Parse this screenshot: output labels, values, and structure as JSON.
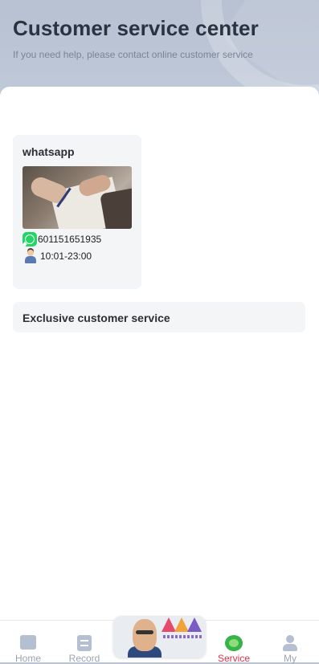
{
  "header": {
    "title": "Customer service center",
    "subtitle": "If you need help, please contact online customer service"
  },
  "whatsapp_card": {
    "title": "whatsapp",
    "phone": "601151651935",
    "hours": "10:01-23:00"
  },
  "exclusive_card": {
    "label": "Exclusive customer service"
  },
  "tabbar": {
    "items": [
      {
        "label": "Home",
        "icon": "home-icon"
      },
      {
        "label": "Record",
        "icon": "record-icon"
      },
      {
        "label": "Service",
        "icon": "service-icon",
        "active": true
      },
      {
        "label": "My",
        "icon": "profile-icon"
      }
    ],
    "center_button": {
      "icon": "game-logo-icon"
    }
  },
  "colors": {
    "header_bg": "#b9c3d3",
    "card_bg": "#f4f5f6",
    "active_tab": "#e0304a",
    "inactive_tab": "#9aa3b2",
    "whatsapp_green": "#25d366"
  }
}
